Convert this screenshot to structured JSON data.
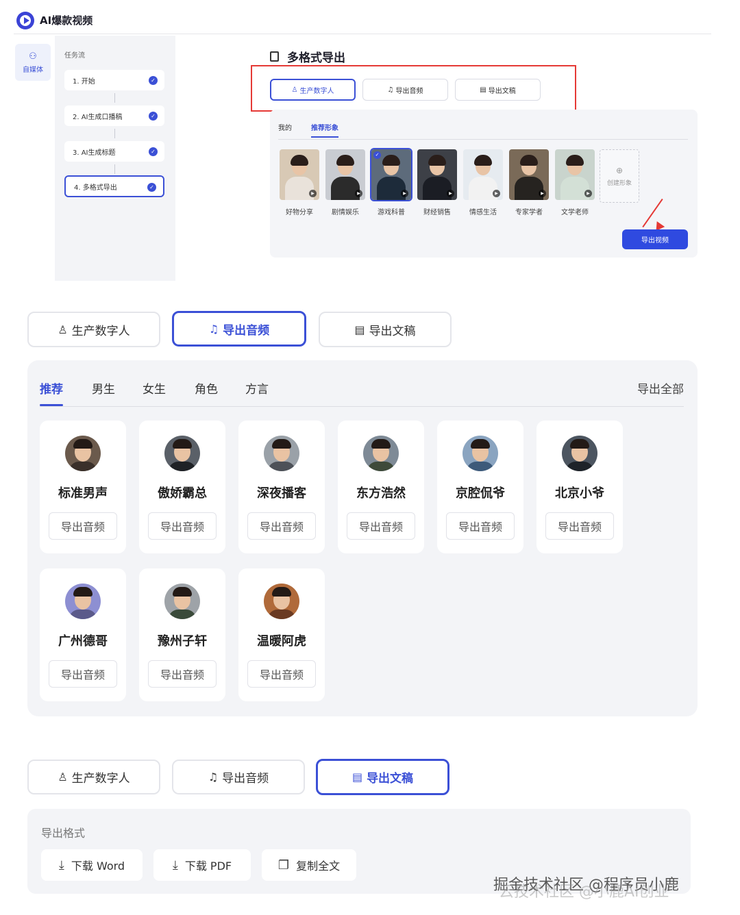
{
  "app": {
    "title": "AI爆款视频"
  },
  "rail": {
    "icon": "users-icon",
    "label": "自媒体"
  },
  "task_panel": {
    "title": "任务流",
    "steps": [
      {
        "label": "1. 开始",
        "done": true
      },
      {
        "label": "2. AI生成口播稿",
        "done": true
      },
      {
        "label": "3. AI生成标题",
        "done": true
      },
      {
        "label": "4. 多格式导出",
        "done": true,
        "active": true
      }
    ],
    "check_glyph": "✓"
  },
  "section": {
    "title": "多格式导出",
    "tabs": [
      {
        "label": "生产数字人",
        "icon": "person-icon",
        "selected": true
      },
      {
        "label": "导出音频",
        "icon": "audio-file-icon",
        "selected": false
      },
      {
        "label": "导出文稿",
        "icon": "document-icon",
        "selected": false
      }
    ],
    "sub_tabs": [
      {
        "label": "我的",
        "active": false
      },
      {
        "label": "推荐形象",
        "active": true
      }
    ],
    "characters": [
      {
        "label": "好物分享",
        "selected": false,
        "bg": "#d8c9b5",
        "body": "#e9e2da"
      },
      {
        "label": "剧情娱乐",
        "selected": false,
        "bg": "#c9ccd2",
        "body": "#2b2b2b"
      },
      {
        "label": "游戏科普",
        "selected": true,
        "bg": "#5d6b7b",
        "body": "#1d2b3a"
      },
      {
        "label": "财经销售",
        "selected": false,
        "bg": "#3d4047",
        "body": "#1b1d24"
      },
      {
        "label": "情感生活",
        "selected": false,
        "bg": "#e6ebf0",
        "body": "#f2f2f2"
      },
      {
        "label": "专家学者",
        "selected": false,
        "bg": "#7a6a58",
        "body": "#262320"
      },
      {
        "label": "文学老师",
        "selected": false,
        "bg": "#c9d4cd",
        "body": "#d3e0d6"
      }
    ],
    "create_label": "创建形象",
    "create_icon": "add-image-icon",
    "export_video_label": "导出视频",
    "play_glyph": "▶"
  },
  "audio": {
    "tabs": [
      {
        "label": "生产数字人",
        "icon": "person-icon",
        "selected": false
      },
      {
        "label": "导出音频",
        "icon": "audio-file-icon",
        "selected": true
      },
      {
        "label": "导出文稿",
        "icon": "document-icon",
        "selected": false
      }
    ],
    "voice_tabs": [
      {
        "label": "推荐",
        "active": true
      },
      {
        "label": "男生",
        "active": false
      },
      {
        "label": "女生",
        "active": false
      },
      {
        "label": "角色",
        "active": false
      },
      {
        "label": "方言",
        "active": false
      }
    ],
    "export_all_label": "导出全部",
    "voices": [
      {
        "name": "标准男声",
        "button": "导出音频",
        "bg": "#6b5a4c",
        "body": "#3a302a"
      },
      {
        "name": "傲娇霸总",
        "button": "导出音频",
        "bg": "#5a6068",
        "body": "#1f2226"
      },
      {
        "name": "深夜播客",
        "button": "导出音频",
        "bg": "#9aa1a8",
        "body": "#4d5158"
      },
      {
        "name": "东方浩然",
        "button": "导出音频",
        "bg": "#7e8a96",
        "body": "#3e4a3a"
      },
      {
        "name": "京腔侃爷",
        "button": "导出音频",
        "bg": "#8aa4c0",
        "body": "#3d5a7a"
      },
      {
        "name": "北京小爷",
        "button": "导出音频",
        "bg": "#4c5560",
        "body": "#1e2329"
      },
      {
        "name": "广州德哥",
        "button": "导出音频",
        "bg": "#8d8fd2",
        "body": "#5b5a8a"
      },
      {
        "name": "豫州子轩",
        "button": "导出音频",
        "bg": "#9ea3a8",
        "body": "#3a4a3a"
      },
      {
        "name": "温暖阿虎",
        "button": "导出音频",
        "bg": "#b06a3a",
        "body": "#6a3a22"
      }
    ]
  },
  "document": {
    "tabs": [
      {
        "label": "生产数字人",
        "icon": "person-icon",
        "selected": false
      },
      {
        "label": "导出音频",
        "icon": "audio-file-icon",
        "selected": false
      },
      {
        "label": "导出文稿",
        "icon": "document-icon",
        "selected": true
      }
    ],
    "format_label": "导出格式",
    "buttons": [
      {
        "label": "下载 Word",
        "icon": "download-icon"
      },
      {
        "label": "下载 PDF",
        "icon": "download-icon"
      },
      {
        "label": "复制全文",
        "icon": "copy-icon"
      }
    ]
  },
  "watermark": {
    "text": "掘金技术社区 @程序员小鹿",
    "faint_text": "云技术社区 @小鹿AI创业"
  },
  "glyphs": {
    "person": "♙",
    "audio": "♫",
    "document": "▤",
    "download": "⤓",
    "copy": "❐",
    "users": "⚇",
    "doc_title": ""
  }
}
